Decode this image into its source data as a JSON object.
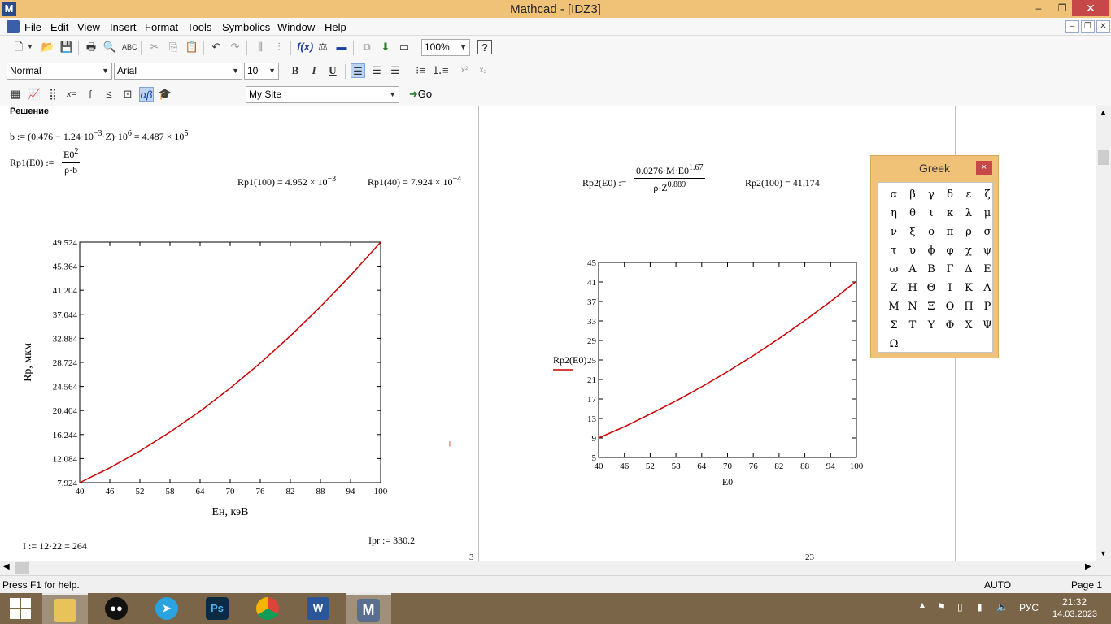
{
  "window": {
    "logo": "M",
    "title": "Mathcad - [IDZ3]",
    "minimize": "–",
    "maximize": "❐",
    "close": "✕"
  },
  "menu": [
    "File",
    "Edit",
    "View",
    "Insert",
    "Format",
    "Tools",
    "Symbolics",
    "Window",
    "Help"
  ],
  "mdi_buttons": [
    "–",
    "❐",
    "✕"
  ],
  "toolbar_standard": {
    "zoom": "100%",
    "icons": [
      "new-icon",
      "open-icon",
      "save-icon",
      "print-icon",
      "print-preview-icon",
      "spell-check-icon",
      "cut-icon",
      "copy-icon",
      "paste-icon",
      "undo-icon",
      "redo-icon",
      "align-icon",
      "insert-function-icon",
      "insert-unit-icon",
      "calculate-icon",
      "component-icon",
      "resources-icon",
      "help-icon"
    ]
  },
  "toolbar_formatting": {
    "style": "Normal",
    "font": "Arial",
    "size": "10",
    "bold": "B",
    "italic": "I",
    "underline": "U"
  },
  "toolbar_math": {
    "site": "My Site",
    "go": "Go"
  },
  "worksheet": {
    "heading": "Решение",
    "b_def": {
      "lhs": "b :=",
      "expr1": "(0.476 − 1.24·10",
      "exp1": "−3",
      "expr2": "·Z)·10",
      "exp2": "6",
      "result": " = 4.487 × 10",
      "exp3": "5"
    },
    "rp1_def": {
      "lhs": "Rp1(E0) :=",
      "num_base": "E0",
      "num_exp": "2",
      "den": "ρ·b"
    },
    "rp1_100": {
      "text": "Rp1(100) = 4.952 × 10",
      "exp": "−3"
    },
    "rp1_40": {
      "text": "Rp1(40) = 7.924 × 10",
      "exp": "−4"
    },
    "rp2_def": {
      "lhs": "Rp2(E0) :=",
      "num_base": "0.0276·M·E0",
      "num_exp": "1.67",
      "den_base": "ρ·Z",
      "den_exp": "0.889"
    },
    "rp2_100": "Rp2(100) = 41.174",
    "i_def": "I := 12·22 = 264",
    "ipr_def": "Ipr := 330.2",
    "page_num_left": "3",
    "page_num_right": "23",
    "cursor": "+"
  },
  "chart_data": [
    {
      "type": "line",
      "title": "",
      "xlabel": "Ен, кэВ",
      "ylabel": "Rp, мкм",
      "xlim": [
        40,
        100
      ],
      "ylim": [
        7.924,
        49.524
      ],
      "x_ticks": [
        "40",
        "46",
        "52",
        "58",
        "64",
        "70",
        "76",
        "82",
        "88",
        "94",
        "100"
      ],
      "y_ticks": [
        "7.924",
        "12.084",
        "16.244",
        "20.404",
        "24.564",
        "28.724",
        "32.884",
        "37.044",
        "41.204",
        "45.364",
        "49.524"
      ],
      "series": [
        {
          "color": "#cc0000",
          "x": [
            40,
            46,
            52,
            58,
            64,
            70,
            76,
            82,
            88,
            94,
            100
          ],
          "y": [
            7.924,
            10.48,
            13.39,
            16.66,
            20.28,
            24.27,
            28.61,
            33.3,
            38.36,
            43.76,
            49.524
          ]
        }
      ]
    },
    {
      "type": "line",
      "title": "",
      "xlabel": "E0",
      "ylabel": "Rp2(E0)",
      "xlim": [
        40,
        100
      ],
      "ylim": [
        5,
        45
      ],
      "x_ticks": [
        "40",
        "46",
        "52",
        "58",
        "64",
        "70",
        "76",
        "82",
        "88",
        "94",
        "100"
      ],
      "y_ticks": [
        "5",
        "9",
        "13",
        "17",
        "21",
        "25",
        "29",
        "33",
        "37",
        "41",
        "45"
      ],
      "series": [
        {
          "color": "#cc0000",
          "x": [
            40,
            46,
            52,
            58,
            64,
            70,
            76,
            82,
            88,
            94,
            100
          ],
          "y": [
            9.0,
            11.3,
            13.9,
            16.6,
            19.5,
            22.6,
            25.9,
            29.4,
            33.1,
            37.0,
            41.174
          ]
        }
      ]
    }
  ],
  "greek": {
    "title": "Greek",
    "close": "×",
    "letters": [
      "α",
      "β",
      "γ",
      "δ",
      "ε",
      "ζ",
      "η",
      "θ",
      "ι",
      "κ",
      "λ",
      "μ",
      "ν",
      "ξ",
      "ο",
      "π",
      "ρ",
      "σ",
      "τ",
      "υ",
      "ϕ",
      "φ",
      "χ",
      "ψ",
      "ω",
      "Α",
      "Β",
      "Γ",
      "Δ",
      "Ε",
      "Ζ",
      "Η",
      "Θ",
      "Ι",
      "Κ",
      "Λ",
      "Μ",
      "Ν",
      "Ξ",
      "Ο",
      "Π",
      "Ρ",
      "Σ",
      "Τ",
      "Υ",
      "Φ",
      "Χ",
      "Ψ",
      "Ω"
    ]
  },
  "scroll": {
    "left": "◀",
    "right": "▶",
    "up": "▲",
    "down": "▼"
  },
  "status": {
    "help": "Press F1 for help.",
    "mode": "AUTO",
    "page": "Page 1"
  },
  "taskbar": {
    "apps": [
      "file-explorer-icon",
      "app-icon",
      "telegram-icon",
      "photoshop-icon",
      "chrome-icon",
      "word-icon",
      "mathcad-icon"
    ],
    "ps_label": "Ps",
    "word_label": "W",
    "mathcad_label": "M",
    "lang": "РУС",
    "time": "21:32",
    "date": "14.03.2023"
  }
}
